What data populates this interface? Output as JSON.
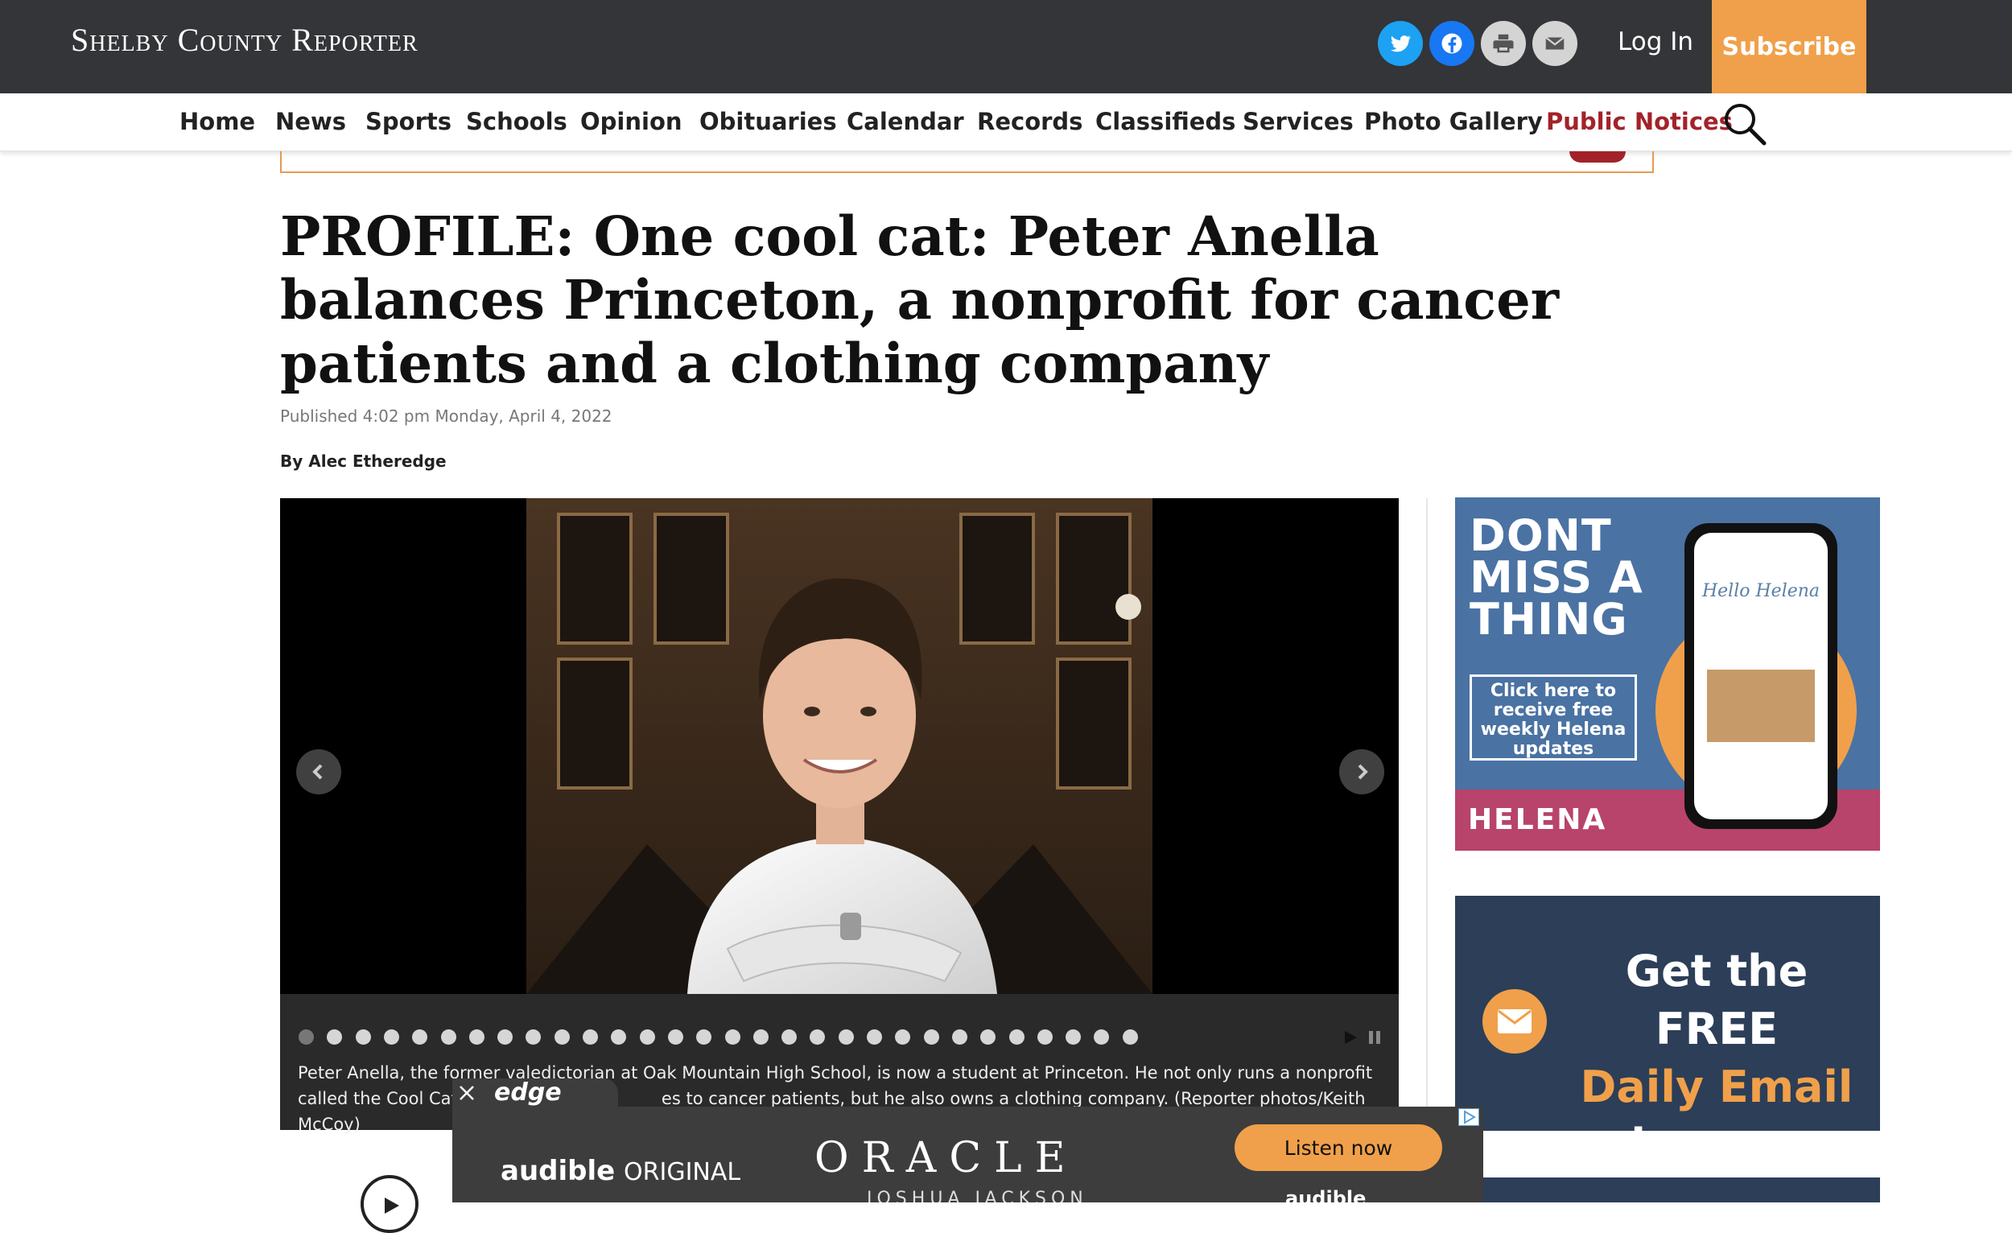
{
  "site": {
    "logo": "Shelby County Reporter"
  },
  "header": {
    "login_label": "Log In",
    "subscribe_label": "Subscribe"
  },
  "social": [
    "twitter-icon",
    "facebook-icon",
    "print-icon",
    "email-icon"
  ],
  "nav": {
    "items": [
      "Home",
      "News",
      "Sports",
      "Schools",
      "Opinion",
      "Obituaries",
      "Calendar",
      "Records",
      "Classifieds",
      "Services",
      "Photo Gallery",
      "Public Notices"
    ]
  },
  "article": {
    "headline": "PROFILE: One cool cat: Peter Anella balances Princeton, a nonprofit for cancer patients and a clothing company",
    "published": "Published 4:02 pm Monday, April 4, 2022",
    "byline": "By Alec Etheredge",
    "caption": "Peter Anella, the former valedictorian at Oak Mountain High School, is now a student at Princeton. He not only runs a nonprofit called the Cool Cat Club that p",
    "caption_rest": "es to cancer patients, but he also owns a clothing company. (Reporter photos/Keith McCoy)",
    "gallery_total": 30,
    "gallery_active": 1
  },
  "ads": {
    "helena_headline": [
      "DONT",
      "MISS A",
      "THING"
    ],
    "helena_cta": "Click here to receive free weekly Helena updates",
    "helena_brand": "HELENA",
    "phone_text": "Hello Helena",
    "email_ad": [
      "Get the FREE",
      "Daily Email",
      "in your inbox"
    ],
    "bottom_edge": "edge",
    "bottom_audible": "audible",
    "bottom_original": "ORIGINAL",
    "bottom_title": "ORACLE",
    "bottom_subtitle": "JOSHUA JACKSON",
    "bottom_cta": "Listen now",
    "bottom_brand": "audible"
  },
  "colors": {
    "topbar": "#333538",
    "subscribe": "#f0a04a",
    "public_notices": "#a3222a",
    "ad_blue": "#4a72a3",
    "ad_navy": "#2c3e58",
    "ad_orange": "#f0a04a",
    "ad_pink": "#b8436b"
  }
}
